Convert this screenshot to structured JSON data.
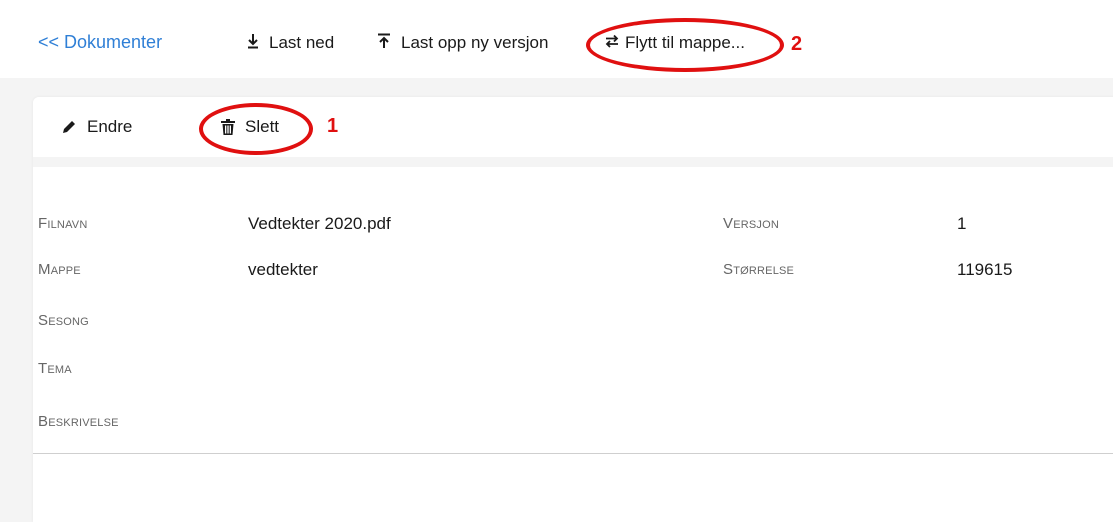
{
  "topbar": {
    "back_link": "<< Dokumenter",
    "download": {
      "icon": "download-icon",
      "glyph": "⭳",
      "label": "Last ned"
    },
    "upload": {
      "icon": "upload-icon",
      "glyph": "⭱",
      "label": "Last opp ny versjon"
    },
    "move": {
      "icon": "swap-arrows-icon",
      "glyph": "⇄",
      "label": "Flytt til mappe..."
    }
  },
  "toolbar": {
    "edit": {
      "icon": "pencil-icon",
      "label": "Endre"
    },
    "delete": {
      "icon": "trash-icon",
      "label": "Slett"
    }
  },
  "details": {
    "filename": {
      "label": "Filnavn",
      "value": "Vedtekter 2020.pdf"
    },
    "folder": {
      "label": "Mappe",
      "value": "vedtekter"
    },
    "season": {
      "label": "Sesong",
      "value": ""
    },
    "theme": {
      "label": "Tema",
      "value": ""
    },
    "description": {
      "label": "Beskrivelse",
      "value": ""
    },
    "version": {
      "label": "Versjon",
      "value": "1"
    },
    "size": {
      "label": "Størrelse",
      "value": "119615"
    }
  },
  "annotations": {
    "first": "1",
    "second": "2",
    "color": "#e01010"
  },
  "colors": {
    "link": "#2f7fd6",
    "background": "#f4f4f4"
  }
}
